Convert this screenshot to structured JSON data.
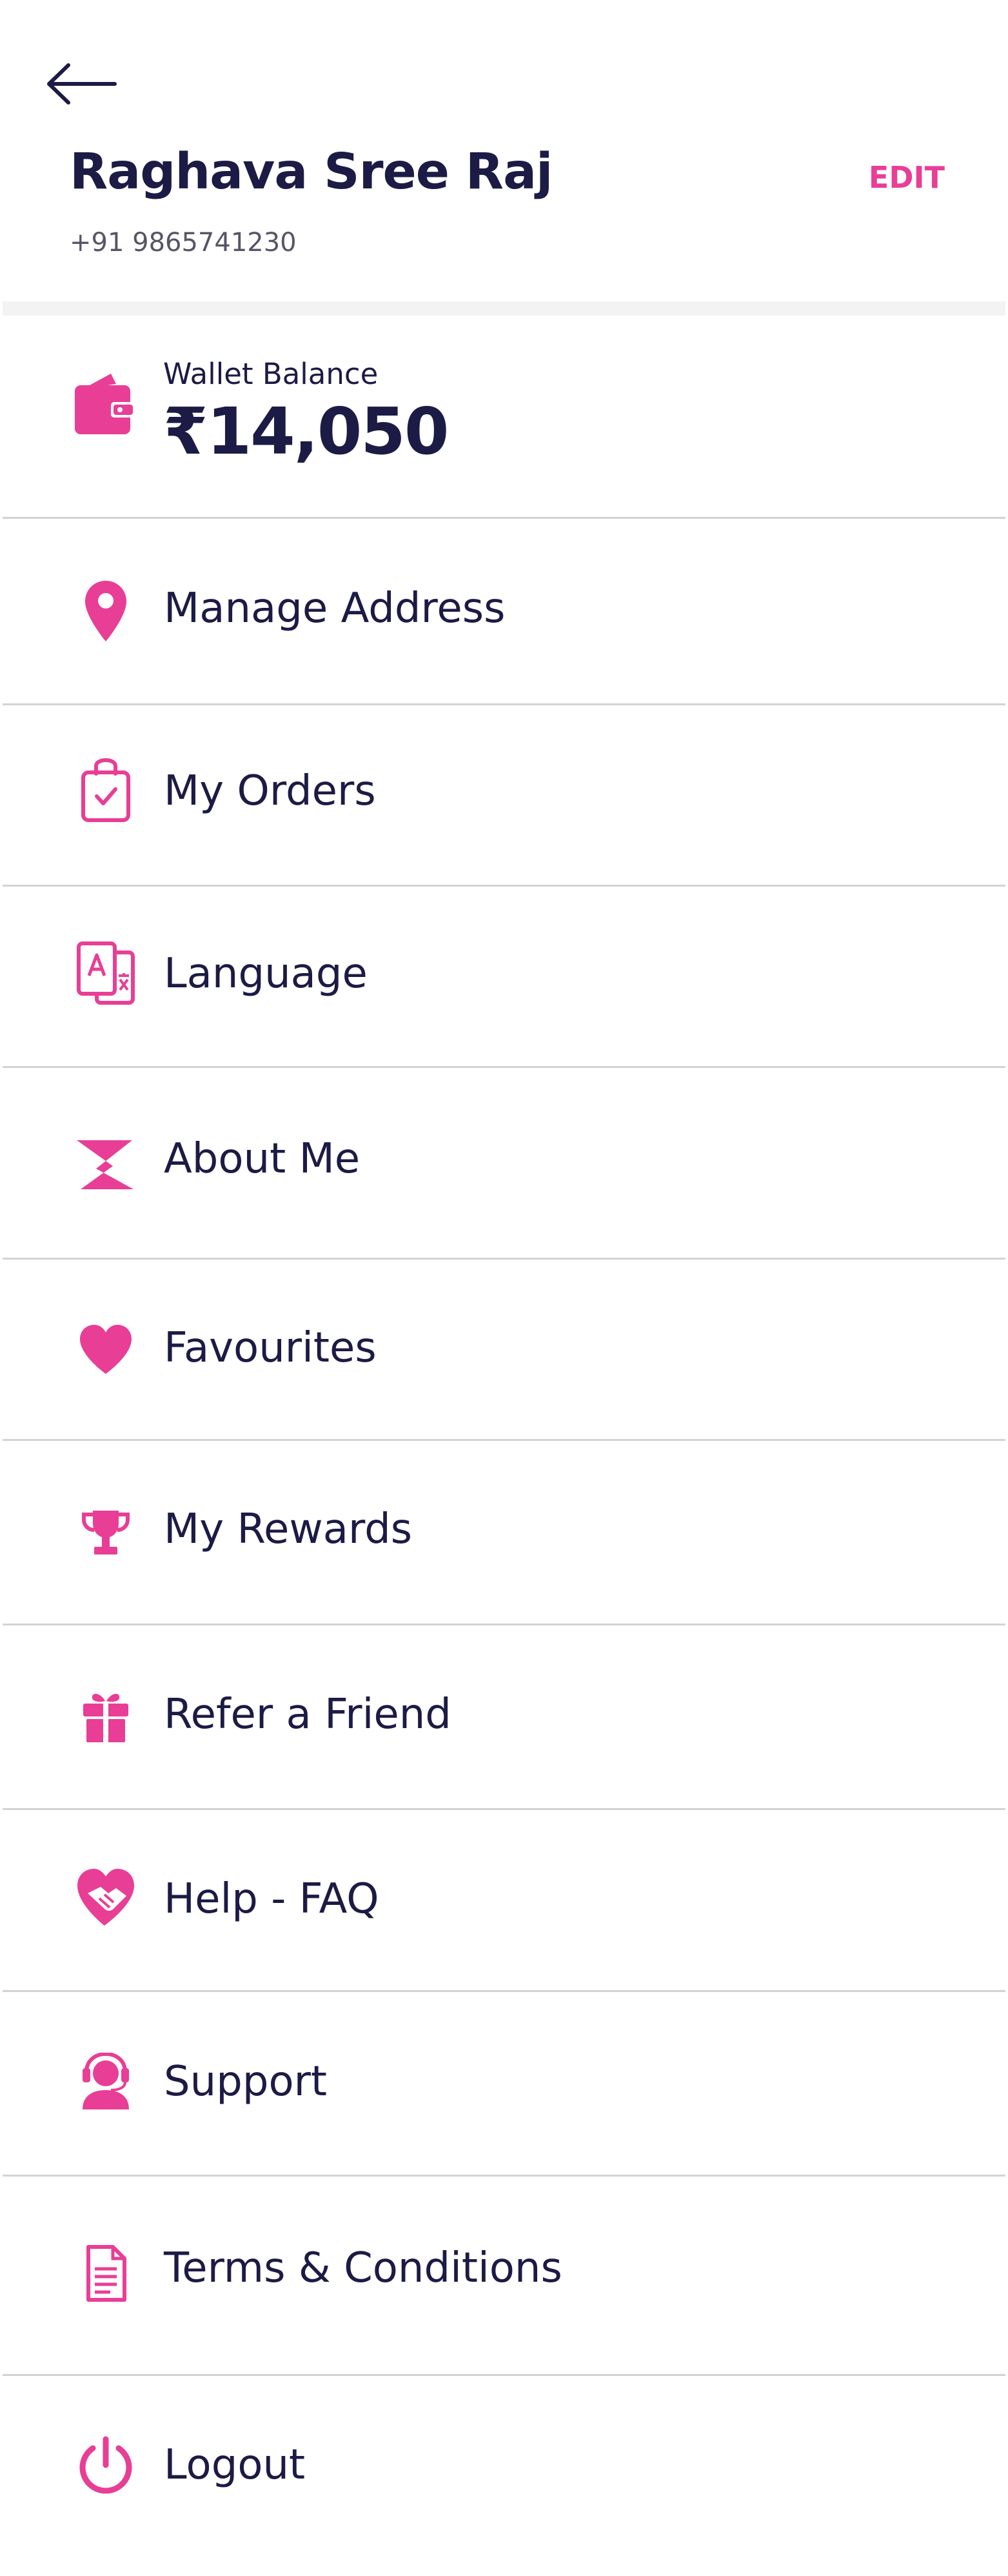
{
  "header": {
    "back_icon": "arrow-left-icon",
    "name": "Raghava Sree Raj",
    "phone": "+91 9865741230",
    "edit_label": "EDIT"
  },
  "wallet": {
    "icon": "wallet-icon",
    "label": "Wallet Balance",
    "amount": "₹14,050"
  },
  "menu": {
    "items": [
      {
        "label": "Manage Address",
        "icon": "location-pin-icon"
      },
      {
        "label": "My Orders",
        "icon": "shopping-bag-icon"
      },
      {
        "label": "Language",
        "icon": "translate-icon"
      },
      {
        "label": "About Me",
        "icon": "brand-z-icon"
      },
      {
        "label": "Favourites",
        "icon": "heart-icon"
      },
      {
        "label": "My Rewards",
        "icon": "trophy-icon"
      },
      {
        "label": "Refer a Friend",
        "icon": "gift-icon"
      },
      {
        "label": "Help - FAQ",
        "icon": "heart-handshake-icon"
      },
      {
        "label": "Support",
        "icon": "headset-agent-icon"
      },
      {
        "label": "Terms & Conditions",
        "icon": "document-icon"
      },
      {
        "label": "Logout",
        "icon": "power-icon"
      }
    ]
  },
  "colors": {
    "accent": "#e83e96",
    "text": "#1c1b45",
    "divider": "#d3d3d6"
  }
}
